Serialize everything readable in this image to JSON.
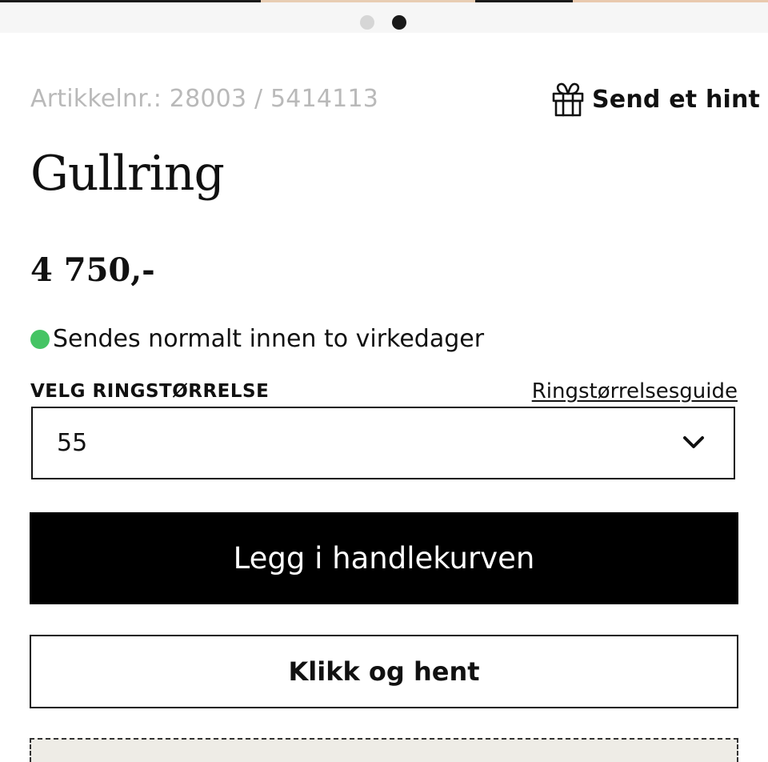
{
  "gallery": {
    "slide_count": 2,
    "active_slide": 2
  },
  "product": {
    "article_number": "Artikkelnr.: 28003 / 5414113",
    "title": "Gullring",
    "price": "4 750,-"
  },
  "hint": {
    "icon": "gift-icon",
    "label": "Send et hint"
  },
  "stock": {
    "status_color": "#45c464",
    "text": "Sendes normalt innen to virkedager"
  },
  "size": {
    "label": "VELG RINGSTØRRELSE",
    "guide_link": "Ringstørrelsesguide",
    "selected": "55"
  },
  "actions": {
    "add_to_cart": "Legg i handlekurven",
    "click_and_collect": "Klikk og hent"
  },
  "colors": {
    "primary": "#000000",
    "muted_text": "#b9b9b9",
    "success": "#45c464"
  }
}
